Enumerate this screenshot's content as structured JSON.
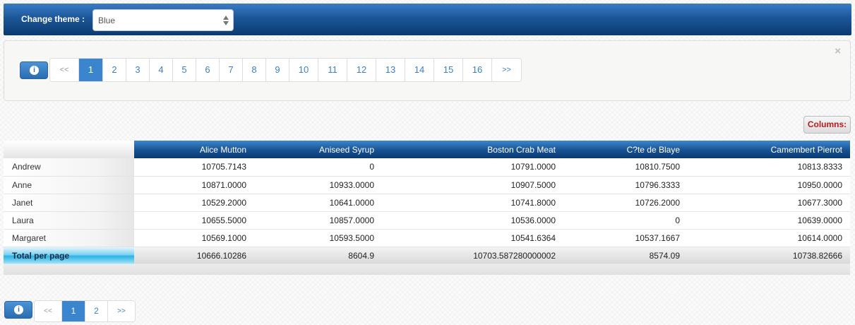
{
  "theme_bar": {
    "label": "Change theme :",
    "selected": "Blue"
  },
  "top_pager": {
    "close": "×",
    "info_icon": "info-icon",
    "prev": "<<",
    "next": ">>",
    "pages": [
      "1",
      "2",
      "3",
      "4",
      "5",
      "6",
      "7",
      "8",
      "9",
      "10",
      "11",
      "12",
      "13",
      "14",
      "15",
      "16"
    ],
    "active": "1"
  },
  "columns_button": "Columns:",
  "grid": {
    "headers": [
      "Alice Mutton",
      "Aniseed Syrup",
      "Boston Crab Meat",
      "C?te de Blaye",
      "Camembert Pierrot"
    ],
    "rows": [
      {
        "name": "Andrew",
        "values": [
          "10705.7143",
          "0",
          "10791.0000",
          "10810.7500",
          "10813.8333"
        ]
      },
      {
        "name": "Anne",
        "values": [
          "10871.0000",
          "10933.0000",
          "10907.5000",
          "10796.3333",
          "10950.0000"
        ]
      },
      {
        "name": "Janet",
        "values": [
          "10529.2000",
          "10641.0000",
          "10741.8000",
          "10726.2000",
          "10677.3000"
        ]
      },
      {
        "name": "Laura",
        "values": [
          "10655.5000",
          "10857.0000",
          "10536.0000",
          "0",
          "10639.0000"
        ]
      },
      {
        "name": "Margaret",
        "values": [
          "10569.1000",
          "10593.5000",
          "10541.6364",
          "10537.1667",
          "10614.0000"
        ]
      }
    ],
    "total": {
      "name": "Total per page",
      "values": [
        "10666.10286",
        "8604.9",
        "10703.587280000002",
        "8574.09",
        "10738.82666"
      ]
    }
  },
  "bottom_pager": {
    "info_icon": "info-icon",
    "prev": "<<",
    "next": ">>",
    "pages": [
      "1",
      "2"
    ],
    "active": "1"
  }
}
